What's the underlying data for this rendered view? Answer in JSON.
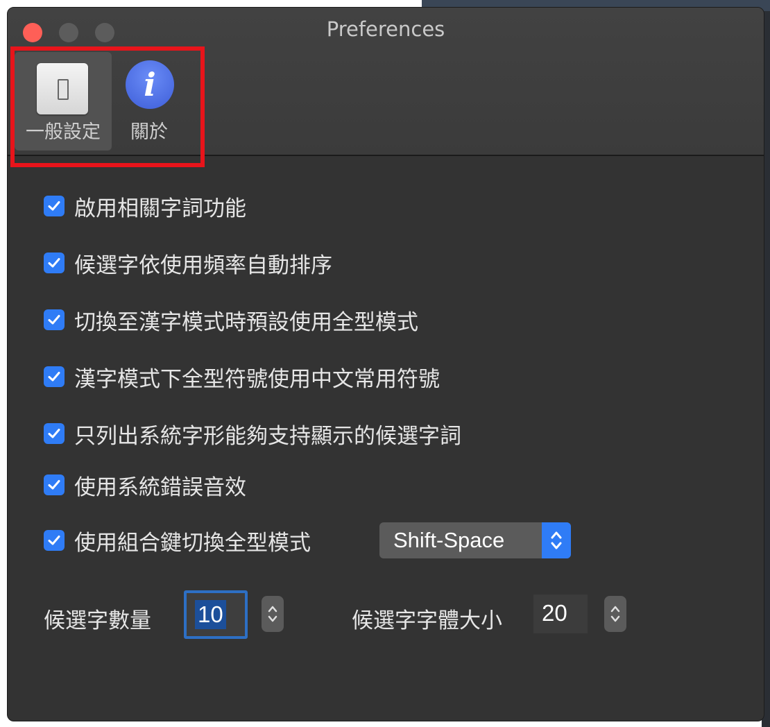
{
  "window": {
    "title": "Preferences"
  },
  "toolbar": {
    "tabs": [
      {
        "label": "一般設定",
        "icon": "general-switch-icon",
        "selected": true
      },
      {
        "label": "關於",
        "icon": "info-icon",
        "selected": false
      }
    ],
    "info_glyph": "i"
  },
  "options": [
    {
      "label": "啟用相關字詞功能",
      "checked": true
    },
    {
      "label": "候選字依使用頻率自動排序",
      "checked": true
    },
    {
      "label": "切換至漢字模式時預設使用全型模式",
      "checked": true
    },
    {
      "label": "漢字模式下全型符號使用中文常用符號",
      "checked": true
    },
    {
      "label": "只列出系統字形能夠支持顯示的候選字詞",
      "checked": true
    },
    {
      "label": "使用系統錯誤音效",
      "checked": true
    },
    {
      "label": "使用組合鍵切換全型模式",
      "checked": true
    }
  ],
  "shortcut_popup": {
    "value": "Shift-Space"
  },
  "candidate_count": {
    "label": "候選字數量",
    "value": "10"
  },
  "candidate_font_size": {
    "label": "候選字字體大小",
    "value": "20"
  },
  "colors": {
    "accent": "#2f7cf6",
    "highlight_box": "#e8141b",
    "window_bg": "#333333",
    "close_button": "#fe5f57"
  }
}
